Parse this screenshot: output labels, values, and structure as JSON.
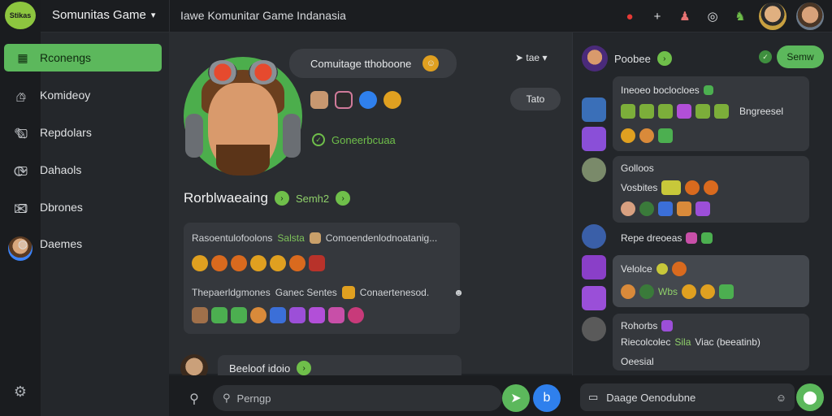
{
  "app": {
    "logo_text": "Stikas",
    "server_name": "Somunitas Game",
    "channel_title": "Iawe Komunitar Game Indanasia"
  },
  "topbar_icons": [
    "mario-icon",
    "plus-icon",
    "joystick-icon",
    "chat-icon",
    "dino-icon"
  ],
  "nav": {
    "items": [
      {
        "label": "Rconengs",
        "icon": "grid-icon",
        "active": true
      },
      {
        "label": "Komideoy",
        "icon": "home-icon",
        "active": false
      },
      {
        "label": "Repdolars",
        "icon": "square-icon",
        "active": false
      },
      {
        "label": "Dahaols",
        "icon": "square-icon",
        "active": false
      },
      {
        "label": "Dbrones",
        "icon": "square-icon",
        "active": false
      },
      {
        "label": "Daemes",
        "icon": "controller-icon",
        "active": false
      }
    ]
  },
  "main": {
    "bubble_title": "Comuitage tthoboone",
    "sort_label": "tae",
    "view_label": "Tato",
    "status_text": "Goneerbcuaa",
    "player_name": "Rorblwaeaing",
    "player_sub": "Semh2",
    "card": {
      "line1_a": "Rasoentulofoolons",
      "line1_b": "Salsta",
      "line1_c": "Comoendenlodnoatanig...",
      "line2_a": "Thepaerldgmones",
      "line2_b": "Ganec Sentes",
      "line2_c": "Conaertenesod."
    },
    "next_message": "Beeloof idoio"
  },
  "composer": {
    "placeholder": "Perngp",
    "right_placeholder": "Daage Oenodubne"
  },
  "right": {
    "header_name": "Poobee",
    "game_button": "Semw",
    "messages": [
      {
        "l1": "Ineoeo boclocloes",
        "l2": "Bngreesel"
      },
      {
        "l1": "Golloos",
        "l2": "Vosbites"
      },
      {
        "l1": "Repe dreoeas",
        "l2": ""
      },
      {
        "l1": "Velolce",
        "l2": "Wbs"
      },
      {
        "l1": "Rohorbs",
        "l2": "Riecolcolec",
        "l2b": "Sila",
        "l2c": "Viac (beeatinb)",
        "l3": "Oeesial"
      }
    ]
  },
  "colors": {
    "accent": "#5cb85c",
    "bg": "#1f2226",
    "panel": "#35383d",
    "blue": "#2f80ed"
  }
}
